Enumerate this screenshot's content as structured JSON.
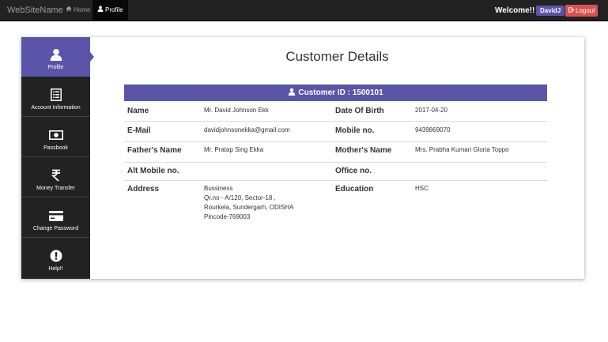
{
  "navbar": {
    "brand": "WebSiteName",
    "home_label": "Home",
    "profile_label": "Profile",
    "welcome": "Welcome!!",
    "username": "DavidJ",
    "logout_label": "Logout"
  },
  "sidebar": {
    "items": [
      {
        "label": "Profile",
        "icon": "user-icon"
      },
      {
        "label": "Account Information",
        "icon": "list-icon"
      },
      {
        "label": "Passbook",
        "icon": "money-icon"
      },
      {
        "label": "Money Transfer",
        "icon": "rupee-icon"
      },
      {
        "label": "Change Password",
        "icon": "credit-card-icon"
      },
      {
        "label": "Help!!",
        "icon": "exclamation-icon"
      }
    ]
  },
  "main": {
    "title": "Customer Details",
    "customer_id_label": "Customer ID : 1500101",
    "fields": {
      "name_label": "Name",
      "name_value": "Mr. David Johnson Ekk",
      "dob_label": "Date Of Birth",
      "dob_value": "2017-04-20",
      "email_label": "E-Mail",
      "email_value": "davidjohnsonekka@gmail.com",
      "mobile_label": "Mobile no.",
      "mobile_value": "9439869070",
      "father_label": "Father's Name",
      "father_value": "Mr. Pratap Sing Ekka",
      "mother_label": "Mother's Name",
      "mother_value": "Mrs. Prabha Kumari Gloria Toppo",
      "alt_mobile_label": "Alt Mobile no.",
      "alt_mobile_value": "",
      "office_label": "Office no.",
      "office_value": "",
      "address_label": "Address",
      "address_lines": [
        "Bussiness",
        "Qr.no - A/120, Sector-18 ,",
        "Rourkela, Sundergarh, ODISHA",
        "Pincode-769003"
      ],
      "education_label": "Education",
      "education_value": "HSC"
    }
  },
  "colors": {
    "accent": "#5a55a8",
    "navbar": "#222222",
    "logout": "#d9534f"
  }
}
